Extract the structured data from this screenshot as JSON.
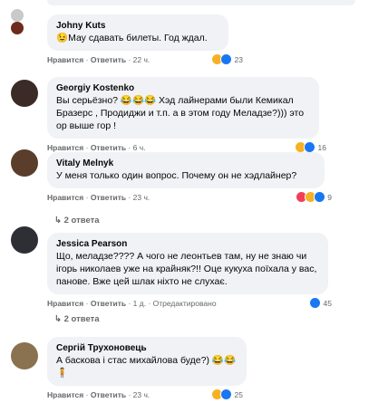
{
  "comments": [
    {
      "author": "Johny Kuts",
      "text": "😉Мау сдавать билеты. Год ждал.",
      "like": "Нравится",
      "reply": "Ответить",
      "time": "22 ч.",
      "reactions": "23"
    },
    {
      "author": "Georgiy Kostenko",
      "text": "Вы серьёзно? 😂😂😂 Хэд лайнерами были Кемикал Бразерс , Продиджи и т.п. а в этом году Меладзе?))) это ор выше гор !",
      "like": "Нравится",
      "reply": "Ответить",
      "time": "6 ч.",
      "reactions": "16"
    },
    {
      "author": "Vitaly Melnyk",
      "text": "У меня только один вопрос. Почему он не хэдлайнер?",
      "like": "Нравится",
      "reply": "Ответить",
      "time": "23 ч.",
      "reactions": "9",
      "replies": "2 ответа"
    },
    {
      "author": "Jessica Pearson",
      "text": "Що, меладзе???? А чого не леонтьев там, ну не знаю чи ігорь николаев уже на крайняк?!! Оце кукуха поїхала у вас, панове. Вже цей шлак ніхто не слухає.",
      "like": "Нравится",
      "reply": "Ответить",
      "time": "1 д.",
      "edited": "Отредактировано",
      "reactions": "45",
      "replies": "2 ответа"
    },
    {
      "author": "Сергій Трухоновець",
      "text": "А баскова і стас михайлова буде?) 😂😂🧍",
      "like": "Нравится",
      "reply": "Ответить",
      "time": "23 ч.",
      "reactions": "25"
    }
  ]
}
